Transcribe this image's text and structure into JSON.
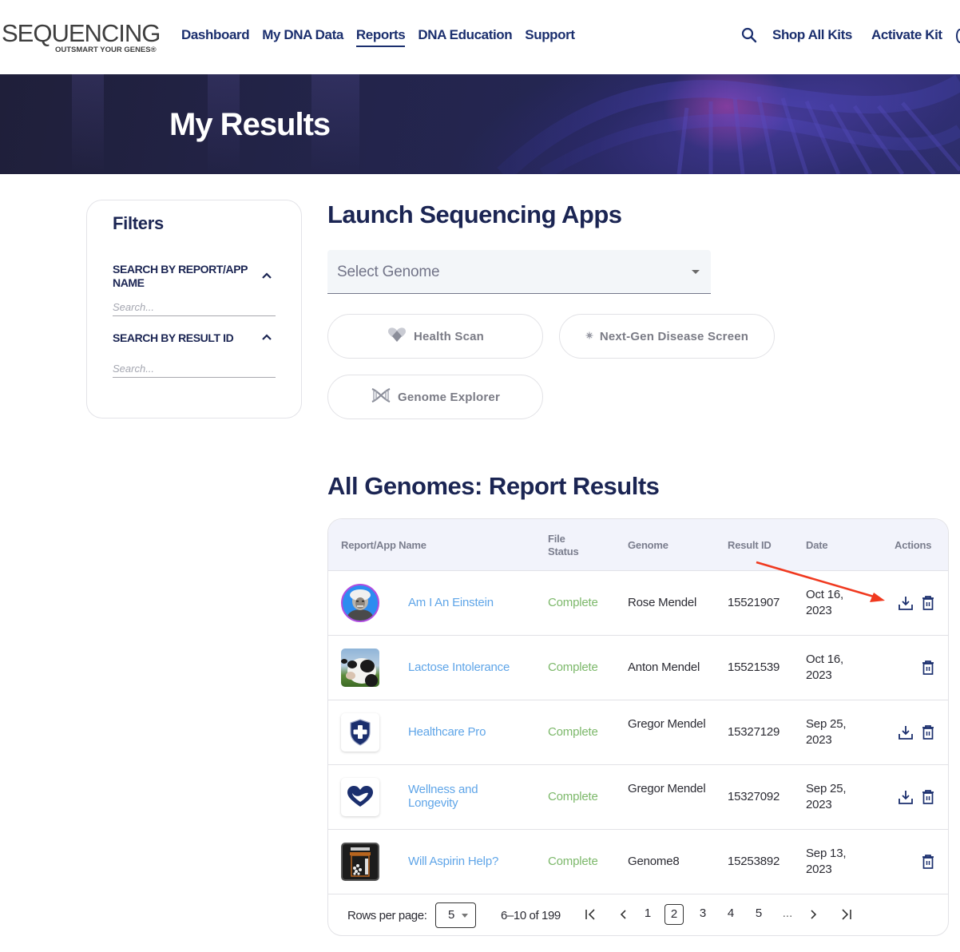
{
  "header": {
    "logo": {
      "wordmark": "SEQUENCING",
      "tagline": "OUTSMART YOUR GENES®"
    },
    "nav": [
      {
        "label": "Dashboard",
        "active": false
      },
      {
        "label": "My DNA Data",
        "active": false
      },
      {
        "label": "Reports",
        "active": true
      },
      {
        "label": "DNA Education",
        "active": false
      },
      {
        "label": "Support",
        "active": false
      }
    ],
    "search_icon": "search-icon",
    "right_links": [
      {
        "label": "Shop All Kits"
      },
      {
        "label": "Activate Kit"
      }
    ]
  },
  "hero": {
    "title": "My Results"
  },
  "filters": {
    "title": "Filters",
    "sections": [
      {
        "title": "SEARCH BY REPORT/APP NAME",
        "placeholder": "Search...",
        "value": "",
        "expanded": true
      },
      {
        "title": "SEARCH BY RESULT ID",
        "placeholder": "Search...",
        "value": "",
        "expanded": true
      }
    ]
  },
  "launch": {
    "title": "Launch Sequencing Apps",
    "select_genome": {
      "placeholder": "Select Genome"
    },
    "apps": [
      {
        "label": "Health Scan",
        "icon": "heart-diamond-icon"
      },
      {
        "label": "Next-Gen Disease Screen",
        "icon": "virus-icon"
      },
      {
        "label": "Genome Explorer",
        "icon": "dna-helix-icon"
      }
    ]
  },
  "results": {
    "title": "All Genomes: Report Results",
    "columns": [
      "Report/App Name",
      "File Status",
      "Genome",
      "Result ID",
      "Date",
      "Actions"
    ],
    "rows": [
      {
        "thumb": "einstein-portrait",
        "name": "Am I An Einstein",
        "status": "Complete",
        "genome": "Rose Mendel",
        "result_id": "15521907",
        "date": "Oct 16, 2023",
        "download": true,
        "delete": true
      },
      {
        "thumb": "cow-photo",
        "name": "Lactose Intolerance",
        "status": "Complete",
        "genome": "Anton Mendel",
        "result_id": "15521539",
        "date": "Oct 16, 2023",
        "download": false,
        "delete": true
      },
      {
        "thumb": "shield-cross-logo",
        "name": "Healthcare Pro",
        "status": "Complete",
        "genome": "Gregor Mendel",
        "result_id": "15327129",
        "date": "Sep 25, 2023",
        "download": true,
        "delete": true
      },
      {
        "thumb": "heart-logo",
        "name": "Wellness and Longevity",
        "status": "Complete",
        "genome": "Gregor Mendel",
        "result_id": "15327092",
        "date": "Sep 25, 2023",
        "download": true,
        "delete": true
      },
      {
        "thumb": "pill-bottle-icon",
        "name": "Will Aspirin Help?",
        "status": "Complete",
        "genome": "Genome8",
        "result_id": "15253892",
        "date": "Sep 13, 2023",
        "download": false,
        "delete": true
      }
    ],
    "pagination": {
      "rows_per_page_label": "Rows per page:",
      "rows_per_page": "5",
      "range": "6–10 of 199",
      "pages": [
        "1",
        "2",
        "3",
        "4",
        "5",
        "..."
      ],
      "current_page": "2"
    }
  },
  "colors": {
    "brand_navy": "#1b2f6e",
    "link_blue": "#5fa5e8",
    "status_green": "#7cb86a",
    "annotation_red": "#f0391f"
  }
}
